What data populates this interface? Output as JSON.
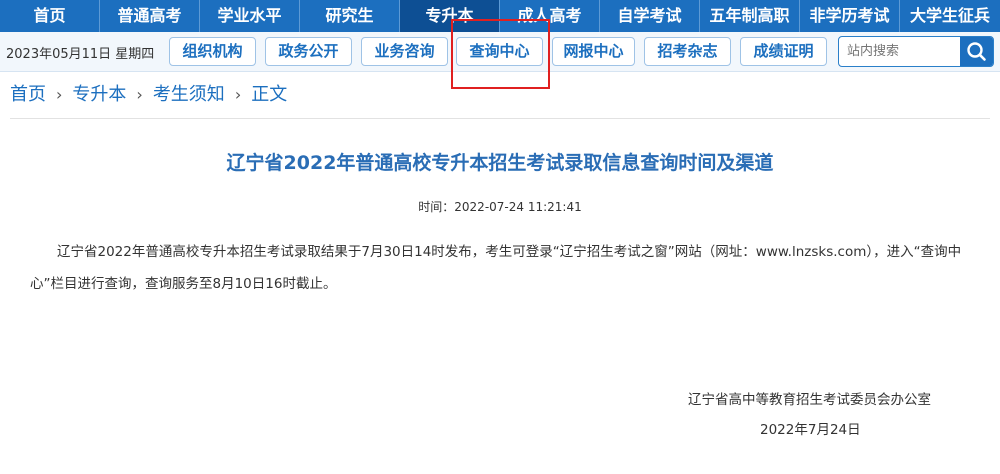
{
  "top_nav": {
    "items": [
      "首页",
      "普通高考",
      "学业水平",
      "研究生",
      "专升本",
      "成人高考",
      "自学考试",
      "五年制高职",
      "非学历考试",
      "大学生征兵"
    ],
    "active_index": 4
  },
  "sub_nav": {
    "date": "2023年05月11日 星期四",
    "buttons": [
      "组织机构",
      "政务公开",
      "业务咨询",
      "查询中心",
      "网报中心",
      "招考杂志",
      "成绩证明"
    ],
    "search_placeholder": "站内搜索"
  },
  "breadcrumb": {
    "items": [
      "首页",
      "专升本",
      "考生须知",
      "正文"
    ]
  },
  "article": {
    "title": "辽宁省2022年普通高校专升本招生考试录取信息查询时间及渠道",
    "time_label": "时间：",
    "time": "2022-07-24 11:21:41",
    "body": "辽宁省2022年普通高校专升本招生考试录取结果于7月30日14时发布，考生可登录“辽宁招生考试之窗”网站（网址：www.lnzsks.com），进入“查询中心”栏目进行查询，查询服务至8月10日16时截止。",
    "signature_org": "辽宁省高中等教育招生考试委员会办公室",
    "signature_date": "2022年7月24日"
  },
  "colors": {
    "nav_blue": "#1c6fbf",
    "nav_active": "#0d4f94",
    "title_blue": "#2a6db5",
    "highlight_red": "#e02020"
  }
}
